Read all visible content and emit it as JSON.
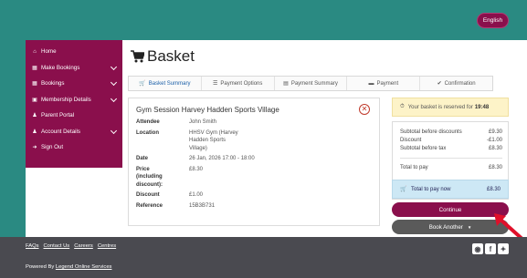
{
  "header": {
    "language_label": "English"
  },
  "sidebar": {
    "items": [
      {
        "label": "Home",
        "icon": "home-icon",
        "has_chevron": false
      },
      {
        "label": "Make Bookings",
        "icon": "calendar-icon",
        "has_chevron": true
      },
      {
        "label": "Bookings",
        "icon": "calendar-icon",
        "has_chevron": true
      },
      {
        "label": "Membership Details",
        "icon": "id-card-icon",
        "has_chevron": true
      },
      {
        "label": "Parent Portal",
        "icon": "user-icon",
        "has_chevron": false
      },
      {
        "label": "Account Details",
        "icon": "user-icon",
        "has_chevron": true
      },
      {
        "label": "Sign Out",
        "icon": "sign-out-icon",
        "has_chevron": false
      }
    ]
  },
  "page": {
    "title": "Basket"
  },
  "steps": [
    {
      "label": "Basket Summary",
      "active": true
    },
    {
      "label": "Payment Options",
      "active": false
    },
    {
      "label": "Payment Summary",
      "active": false
    },
    {
      "label": "Payment",
      "active": false
    },
    {
      "label": "Confirmation",
      "active": false
    }
  ],
  "booking": {
    "title": "Gym Session Harvey Hadden Sports Village",
    "details": [
      {
        "label": "Attendee",
        "value": "John Smith"
      },
      {
        "label": "Location",
        "value": "HHSV Gym (Harvey Hadden Sports Village)"
      },
      {
        "label": "Date",
        "value": "26 Jan, 2026 17:00 - 18:00"
      },
      {
        "label": "Price (including discount):",
        "value": "£8.30"
      },
      {
        "label": "Discount",
        "value": "£1.00"
      },
      {
        "label": "Reference",
        "value": "15B3B731"
      }
    ]
  },
  "reservation": {
    "text": "Your basket is reserved for",
    "time": "19:48"
  },
  "summary": {
    "subtotal_before_discounts": {
      "label": "Subtotal before discounts",
      "value": "£9.30"
    },
    "discount": {
      "label": "Discount",
      "value": "-£1.00"
    },
    "subtotal_before_tax": {
      "label": "Subtotal before tax",
      "value": "£8.30"
    },
    "total_to_pay": {
      "label": "Total to pay",
      "value": "£8.30"
    },
    "pay_now": {
      "label": "Total to pay now",
      "value": "£8.30"
    }
  },
  "actions": {
    "continue_label": "Continue",
    "book_another_label": "Book Another"
  },
  "footer": {
    "links": [
      "FAQs",
      "Contact Us",
      "Careers",
      "Centres"
    ],
    "powered_prefix": "Powered By",
    "powered_link": "Legend Online Services"
  },
  "colors": {
    "brand": "#8a0f4c",
    "teal": "#2a8a82",
    "footer": "#4a4a50",
    "annotation_arrow": "#e0102a"
  }
}
